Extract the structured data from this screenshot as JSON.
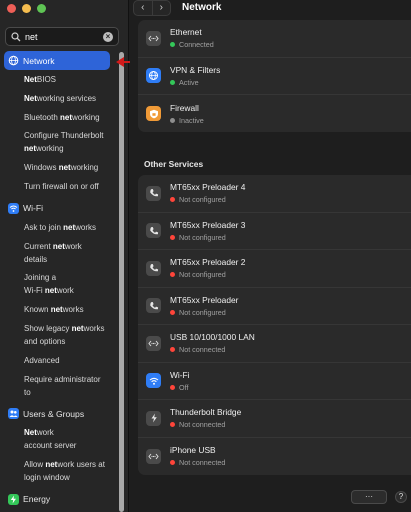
{
  "search": {
    "value": "net"
  },
  "sidebar": {
    "categories": [
      {
        "label": "Network",
        "icon": "globe-icon",
        "color": "#2e64d8"
      },
      {
        "label": "Wi-Fi",
        "icon": "wifi-icon",
        "color": "#2f7df6"
      },
      {
        "label": "Users & Groups",
        "icon": "users-icon",
        "color": "#2f7df6"
      },
      {
        "label": "Energy",
        "icon": "energy-icon",
        "color": "#34c759"
      }
    ],
    "network_items": [
      [
        "NetBIOS"
      ],
      [
        "Networking services"
      ],
      [
        "Bluetooth networking"
      ],
      [
        "Configure Thunderbolt",
        "networking"
      ],
      [
        "Windows networking"
      ],
      [
        "Turn firewall on or off"
      ]
    ],
    "wifi_items": [
      [
        "Ask to join networks"
      ],
      [
        "Current network",
        "details"
      ],
      [
        "Joining a",
        "Wi-Fi network"
      ],
      [
        "Known networks"
      ],
      [
        "Show legacy networks",
        "and options"
      ],
      [
        "Advanced"
      ],
      [
        "Require administrator",
        "to"
      ]
    ],
    "users_items": [
      [
        "Network",
        "account server"
      ],
      [
        "Allow network users at",
        "login window"
      ]
    ]
  },
  "main": {
    "title": "Network",
    "nav_back": "‹",
    "nav_forward": "›",
    "top_services": [
      {
        "name": "Ethernet",
        "status": "Connected",
        "status_color": "#34c759",
        "icon": "ethernet-icon",
        "icon_bg": "#4a4a4a"
      },
      {
        "name": "VPN & Filters",
        "status": "Active",
        "status_color": "#34c759",
        "icon": "vpn-globe-icon",
        "icon_bg": "#2f7df6"
      },
      {
        "name": "Firewall",
        "status": "Inactive",
        "status_color": "#8e8e8e",
        "icon": "firewall-icon",
        "icon_bg": "#f09a37"
      }
    ],
    "other_label": "Other Services",
    "other_services": [
      {
        "name": "MT65xx Preloader 4",
        "status": "Not configured",
        "status_color": "#ff453a",
        "icon": "phone-icon",
        "icon_bg": "#4a4a4a"
      },
      {
        "name": "MT65xx Preloader 3",
        "status": "Not configured",
        "status_color": "#ff453a",
        "icon": "phone-icon",
        "icon_bg": "#4a4a4a"
      },
      {
        "name": "MT65xx Preloader 2",
        "status": "Not configured",
        "status_color": "#ff453a",
        "icon": "phone-icon",
        "icon_bg": "#4a4a4a"
      },
      {
        "name": "MT65xx Preloader",
        "status": "Not configured",
        "status_color": "#ff453a",
        "icon": "phone-icon",
        "icon_bg": "#4a4a4a"
      },
      {
        "name": "USB 10/100/1000 LAN",
        "status": "Not connected",
        "status_color": "#ff453a",
        "icon": "ethernet-icon",
        "icon_bg": "#4a4a4a"
      },
      {
        "name": "Wi-Fi",
        "status": "Off",
        "status_color": "#ff453a",
        "icon": "wifi-icon",
        "icon_bg": "#2f7df6"
      },
      {
        "name": "Thunderbolt Bridge",
        "status": "Not connected",
        "status_color": "#ff453a",
        "icon": "thunderbolt-icon",
        "icon_bg": "#4a4a4a"
      },
      {
        "name": "iPhone USB",
        "status": "Not connected",
        "status_color": "#ff453a",
        "icon": "ethernet-icon",
        "icon_bg": "#4a4a4a"
      }
    ],
    "more_label": "···",
    "help_label": "?"
  }
}
